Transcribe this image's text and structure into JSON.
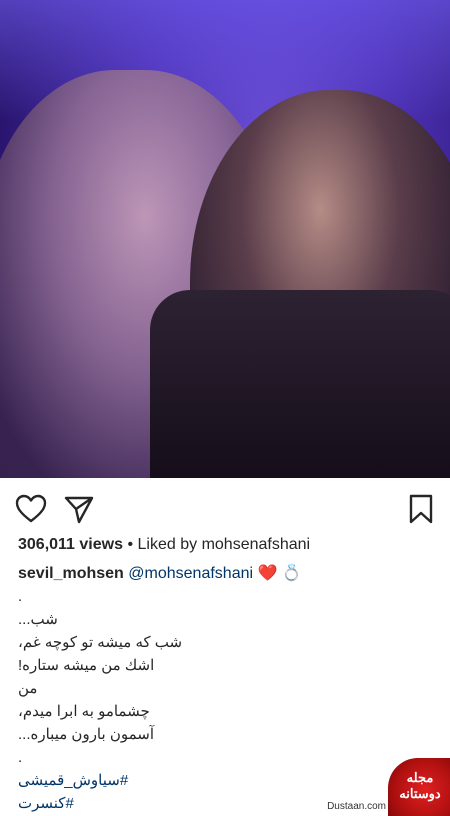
{
  "post": {
    "views_count": "306,011",
    "views_label": "views",
    "separator": "•",
    "liked_by_prefix": "Liked by",
    "liked_by_user": "mohsenafshani",
    "username": "sevil_mohsen",
    "mention": "@mohsenafshani",
    "emoji": "❤️ 💍",
    "caption_lines": [
      ".",
      "شب...",
      "شب که میشه تو کوچه غم،",
      "اشك من میشه ستاره!",
      "من",
      "چشمامو به ابرا میدم،",
      "آسمون بارون میباره...",
      "."
    ],
    "hashtags": [
      "#سیاوش_قمیشی",
      "#کنسرت"
    ]
  },
  "icons": {
    "like": "heart-outline-icon",
    "share": "paper-plane-icon",
    "save": "bookmark-outline-icon"
  },
  "watermark": {
    "logo_text": "مجله دوستانه",
    "site": "Dustaan.com"
  },
  "colors": {
    "text": "#262626",
    "link": "#003569",
    "watermark": "#c01515"
  }
}
